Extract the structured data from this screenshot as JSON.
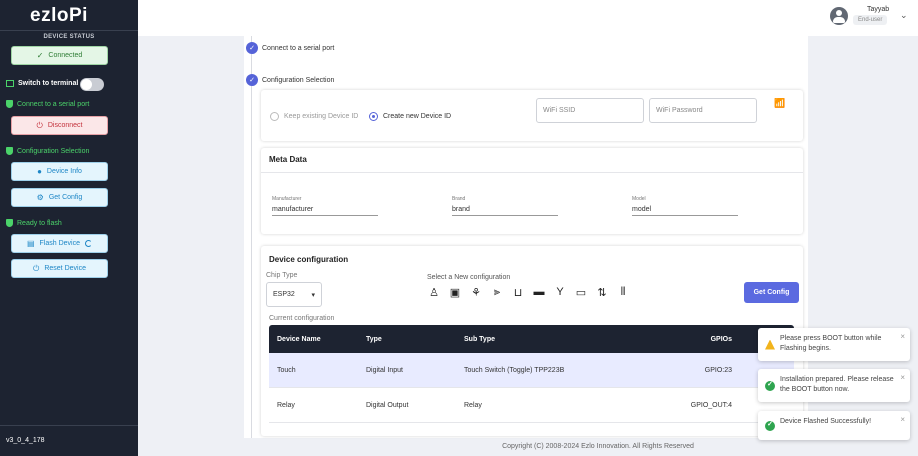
{
  "sidebar": {
    "logo": "ezloPi",
    "status_heading": "DEVICE STATUS",
    "connected_label": "Connected",
    "terminal_label": "Switch to terminal",
    "connect_serial_label": "Connect to a serial port",
    "disconnect_label": "Disconnect",
    "config_selection_label": "Configuration Selection",
    "device_info_label": "Device Info",
    "get_config_label": "Get Config",
    "ready_to_flash_label": "Ready to flash",
    "flash_device_label": "Flash Device",
    "reset_device_label": "Reset Device",
    "version": "v3_0_4_178"
  },
  "header": {
    "user_name": "Tayyab",
    "user_role": "End-user"
  },
  "steps": {
    "step1": "Connect to a serial port",
    "step2": "Configuration Selection"
  },
  "device_id": {
    "keep_label": "Keep existing Device ID",
    "create_label": "Create new Device ID",
    "selected": "create",
    "wifi_ssid_placeholder": "WiFi SSID",
    "wifi_password_placeholder": "WiFi Password"
  },
  "meta": {
    "title": "Meta Data",
    "manufacturer_label": "Manufacturer",
    "manufacturer_value": "manufacturer",
    "brand_label": "Brand",
    "brand_value": "brand",
    "model_label": "Model",
    "model_value": "model"
  },
  "device_config": {
    "title": "Device configuration",
    "chip_type_label": "Chip Type",
    "chip_type_value": "ESP32",
    "new_config_label": "Select a New configuration",
    "get_config_button": "Get Config",
    "current_config_label": "Current configuration",
    "icon_names": [
      "led-icon",
      "relay-icon",
      "sensor-icon",
      "dimmer-icon",
      "u-shape-icon",
      "ir-icon",
      "antenna-icon",
      "lcd-icon",
      "swap-icon",
      "gpio-icon"
    ],
    "columns": [
      "Device Name",
      "Type",
      "Sub Type",
      "GPIOs"
    ],
    "rows": [
      {
        "name": "Touch",
        "type": "Digital Input",
        "subtype": "Touch Switch (Toggle) TPP223B",
        "gpio": "GPIO:23"
      },
      {
        "name": "Relay",
        "type": "Digital Output",
        "subtype": "Relay",
        "gpio": "GPIO_OUT:4"
      }
    ]
  },
  "footer": "Copyright (C) 2008-2024 Ezlo Innovation. All Rights Reserved",
  "toasts": [
    {
      "type": "warning",
      "text": "Please press BOOT button while Flashing begins."
    },
    {
      "type": "success",
      "text": "Installation prepared. Please release the BOOT button now."
    },
    {
      "type": "success",
      "text": "Device Flashed Successfully!"
    }
  ]
}
